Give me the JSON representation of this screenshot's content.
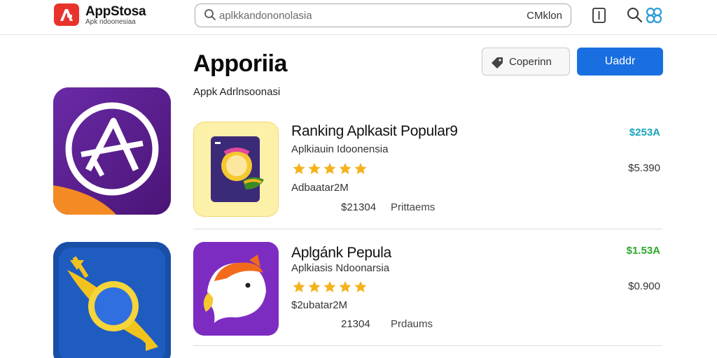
{
  "header": {
    "brand": "AppStosa",
    "brand_sub": "Apk ndoonesiaa",
    "search_placeholder": "aplkkandononolasia",
    "search_action": "CMklon"
  },
  "page": {
    "title": "Apporiia",
    "subtitle": "Appk Adrlnsoonasi",
    "open_button": "Coperinn",
    "primary_button": "Uaddr"
  },
  "rows": [
    {
      "name": "Ranking Aplkasit Popular9",
      "category": "Aplkiauin Idoonensia",
      "rating": 5,
      "developer": "Adbaatar2M",
      "count": "$21304",
      "count_label": "Prittaems",
      "price": "$253A",
      "price_color": "#1aa3b8",
      "price_sub": "$5.390"
    },
    {
      "name": "Aplgánk Pepula",
      "category": "Aplkiasis Ndoonarsia",
      "rating": 5,
      "developer": "$2ubatar2M",
      "count": "21304",
      "count_label": "Prdaums",
      "price": "$1.53A",
      "price_color": "#2aa82a",
      "price_sub": "$0.900"
    }
  ],
  "colors": {
    "accent": "#1a6fe0",
    "logo": "#e8332b",
    "star": "#f4b21c"
  }
}
